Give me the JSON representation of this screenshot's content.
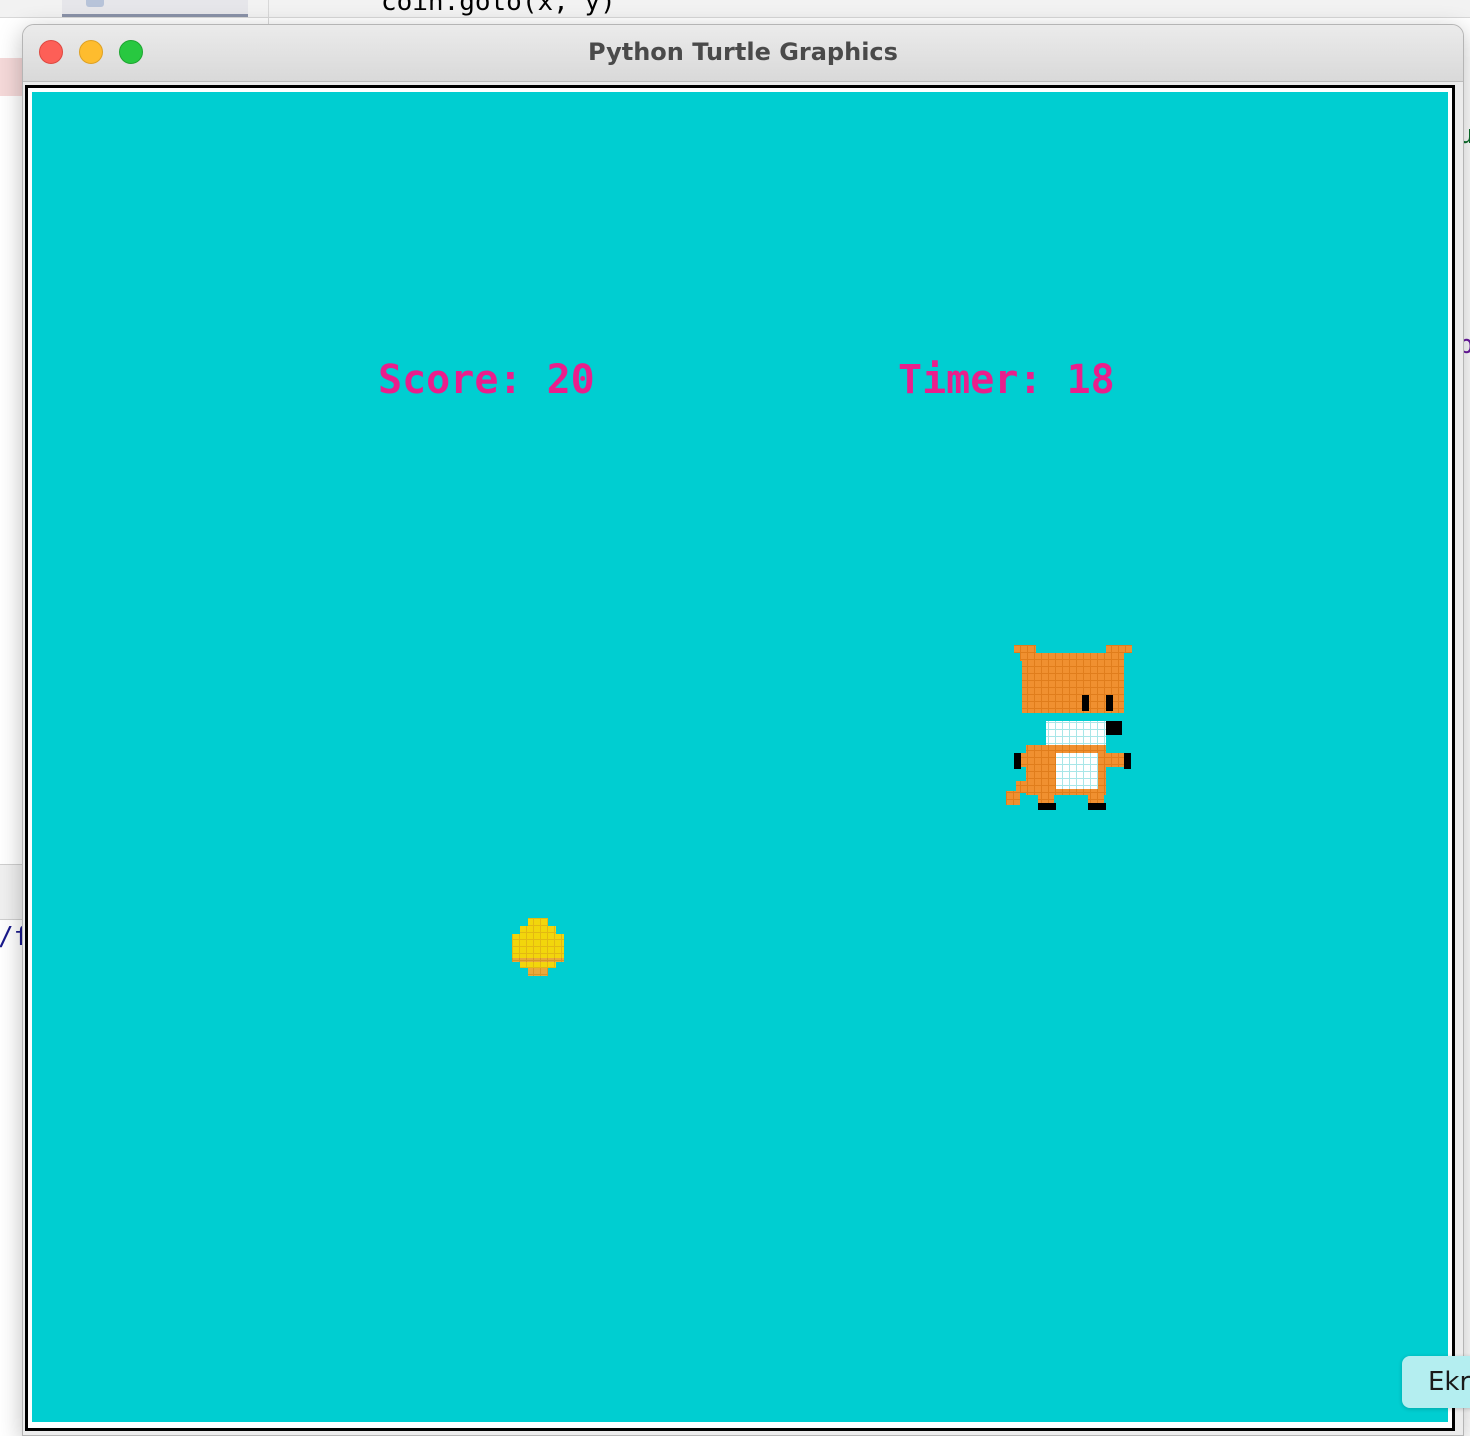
{
  "window": {
    "title": "Python Turtle Graphics",
    "canvas_color": "#00ced1",
    "controls": [
      "close",
      "minimize",
      "maximize"
    ]
  },
  "hud": {
    "score_text": "Score: 20",
    "timer_text": "Timer: 18",
    "text_color": "#ea1e8c"
  },
  "sprites": {
    "player": "fox-icon",
    "pickup": "coin-icon"
  },
  "background_app": {
    "top_code": "   coin.goto(x, y)",
    "console_snippet": "/f",
    "right_snippet_1": "u",
    "right_snippet_2": "p"
  },
  "floating_button": {
    "label": "Ekr"
  }
}
